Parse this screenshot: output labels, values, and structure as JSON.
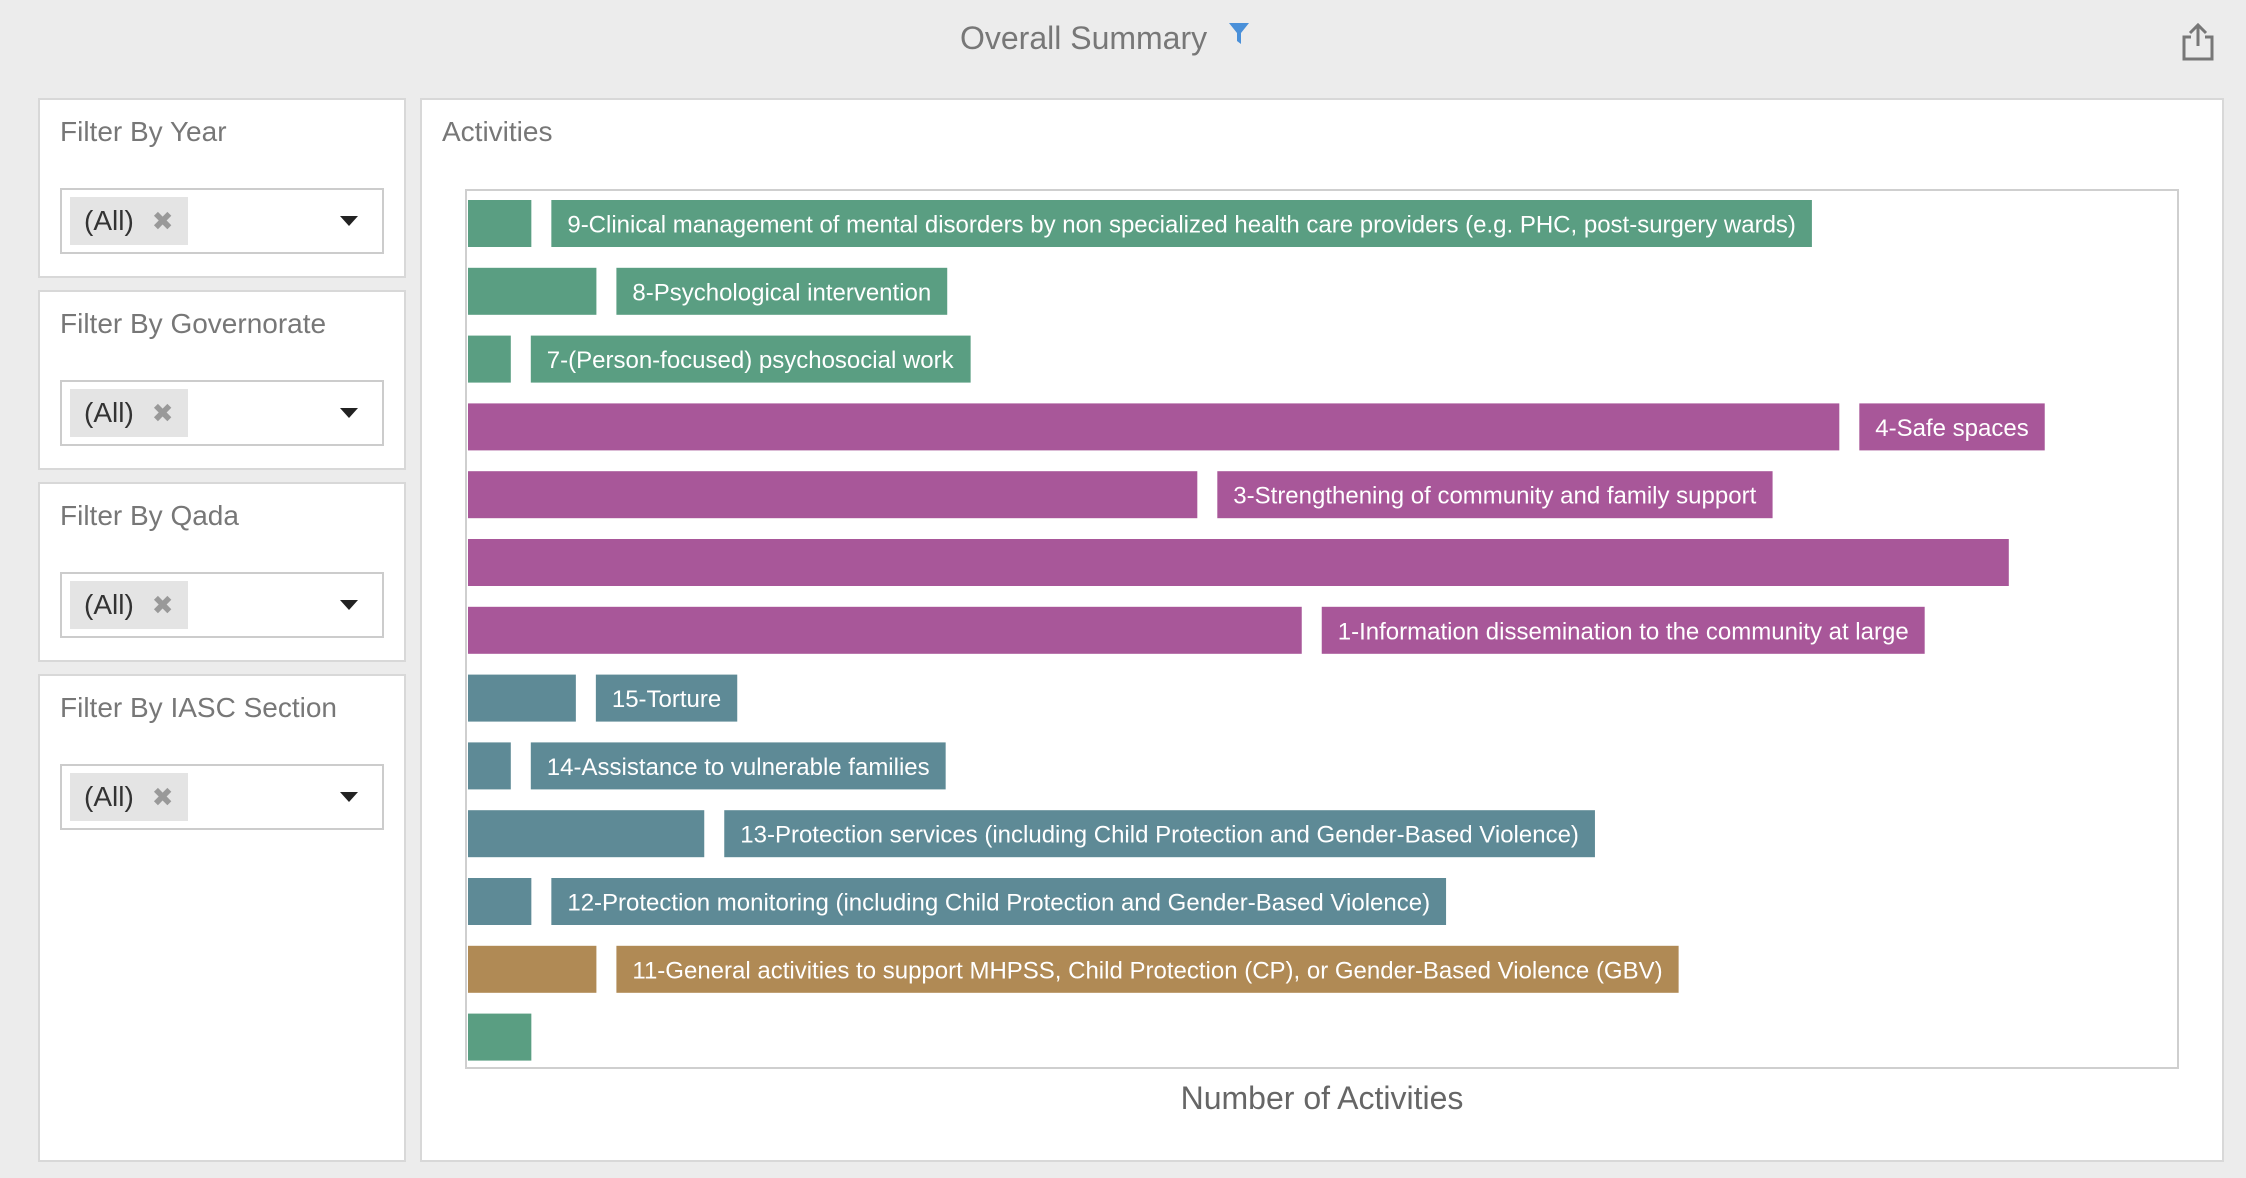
{
  "header": {
    "title": "Overall Summary"
  },
  "icons": {
    "filter": "filter-funnel-icon",
    "share": "share-export-icon",
    "remove": "close-x-icon",
    "dropdown": "caret-down-icon"
  },
  "filters": [
    {
      "label": "Filter By Year",
      "value": "(All)"
    },
    {
      "label": "Filter By Governorate",
      "value": "(All)"
    },
    {
      "label": "Filter By Qada",
      "value": "(All)"
    },
    {
      "label": "Filter By IASC Section",
      "value": "(All)"
    }
  ],
  "colors": {
    "accent": "#4a90d9",
    "green": "#5a9e82",
    "purple": "#a85799",
    "steel": "#5e8a96",
    "brown": "#b08a55",
    "frame": "#cfcfcf"
  },
  "chart_data": {
    "type": "bar",
    "orientation": "horizontal",
    "title": "Activities",
    "xlabel": "Number of Activities",
    "ylabel": "",
    "xlim": [
      0,
      100
    ],
    "grid": false,
    "legend": "none",
    "bars": [
      {
        "label": "9-Clinical management of mental disorders by non specialized health care providers (e.g. PHC, post-surgery wards)",
        "value": 3.7,
        "color": "#5a9e82"
      },
      {
        "label": "8-Psychological intervention",
        "value": 7.5,
        "color": "#5a9e82"
      },
      {
        "label": "7-(Person-focused) psychosocial work",
        "value": 2.5,
        "color": "#5a9e82"
      },
      {
        "label": "4-Safe spaces",
        "value": 80.1,
        "color": "#a85799"
      },
      {
        "label": "3-Strengthening of community and family support",
        "value": 42.6,
        "color": "#a85799"
      },
      {
        "label": "",
        "value": 90.0,
        "color": "#a85799"
      },
      {
        "label": "1-Information dissemination to the community at large",
        "value": 48.7,
        "color": "#a85799"
      },
      {
        "label": "15-Torture",
        "value": 6.3,
        "color": "#5e8a96"
      },
      {
        "label": "14-Assistance to vulnerable families",
        "value": 2.5,
        "color": "#5e8a96"
      },
      {
        "label": "13-Protection services (including Child Protection and Gender-Based Violence)",
        "value": 13.8,
        "color": "#5e8a96"
      },
      {
        "label": "12-Protection monitoring (including Child Protection and Gender-Based Violence)",
        "value": 3.7,
        "color": "#5e8a96"
      },
      {
        "label": "11-General activities to support MHPSS, Child Protection (CP), or Gender-Based Violence (GBV)",
        "value": 7.5,
        "color": "#b08a55"
      },
      {
        "label": "",
        "value": 3.7,
        "color": "#5a9e82"
      }
    ]
  }
}
